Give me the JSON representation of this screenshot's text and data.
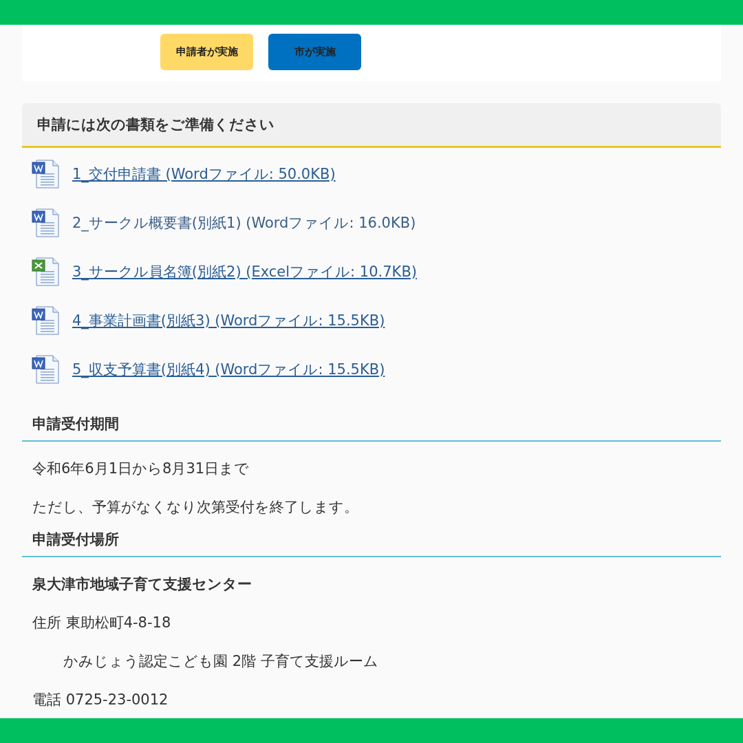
{
  "legend": [
    {
      "lines": [
        "申請者が",
        "実施"
      ],
      "color": "#ffd966"
    },
    {
      "lines": [
        "市が実施"
      ],
      "color": "#0070c0"
    }
  ],
  "documents_heading": "申請には次の書類をご準備ください",
  "documents": [
    {
      "kind": "word",
      "label": "1_交付申請書 (Wordファイル: 50.0KB)",
      "underlined": true
    },
    {
      "kind": "word",
      "label": "2_サークル概要書(別紙1) (Wordファイル: 16.0KB)",
      "underlined": false
    },
    {
      "kind": "excel",
      "label": "3_サークル員名簿(別紙2) (Excelファイル: 10.7KB)",
      "underlined": true
    },
    {
      "kind": "word",
      "label": "4_事業計画書(別紙3) (Wordファイル: 15.5KB)",
      "underlined": true
    },
    {
      "kind": "word",
      "label": "5_収支予算書(別紙4) (Wordファイル: 15.5KB)",
      "underlined": true
    }
  ],
  "sections": [
    {
      "heading": "申請受付期間",
      "lines": [
        {
          "kind": "text",
          "text": "令和6年6月1日から8月31日まで"
        },
        {
          "kind": "text",
          "text": "ただし、予算がなくなり次第受付を終了します。"
        }
      ]
    },
    {
      "heading": "申請受付場所",
      "lines": [
        {
          "kind": "bold",
          "text": "泉大津市地域子育て支援センター"
        },
        {
          "kind": "text",
          "text": "住所 東助松町4-8-18"
        },
        {
          "kind": "indent",
          "text": "かみじょう認定こども園 2階 子育て支援ルーム"
        },
        {
          "kind": "text",
          "text": "電話 0725-23-0012"
        }
      ]
    }
  ]
}
